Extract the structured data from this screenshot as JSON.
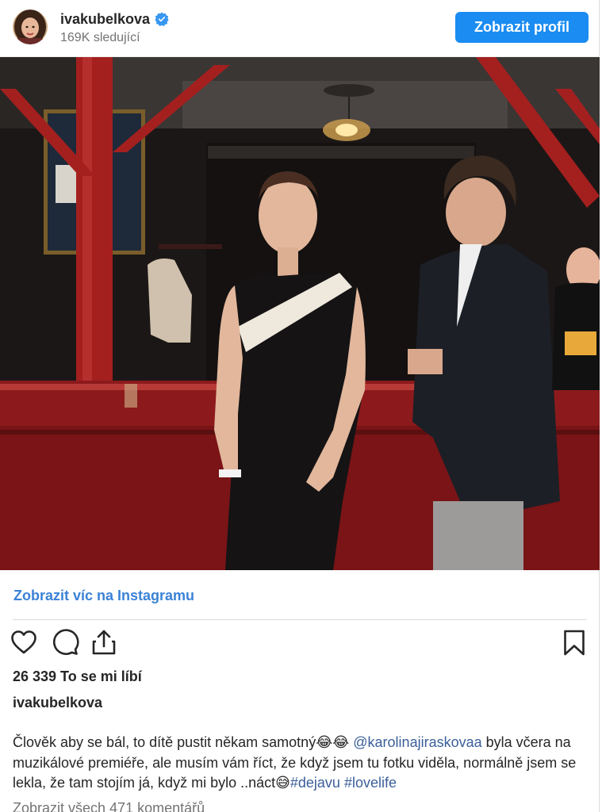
{
  "header": {
    "username": "ivakubelkova",
    "followers": "169K sledující",
    "profile_button": "Zobrazit profil",
    "verified_color": "#3897f0"
  },
  "post": {
    "photo_alt": "Photo of a young woman in a black and white one-shoulder dress next to a man in a dark suit jacket",
    "more_link": "Zobrazit víc na Instagramu",
    "likes": "26 339 To se mi líbí",
    "caption_user": "ivakubelkova",
    "caption_text_1": "Člověk aby se bál, to dítě pustit někam samotný😂😂 ",
    "caption_mention": "@karolinajiraskovaa",
    "caption_text_2": " byla včera na muzikálové premiéře, ale musím vám říct, že když jsem tu fotku viděla, normálně jsem se lekla, že tam stojím já, když mi bylo ..náct😅",
    "hashtag_1": "#dejavu",
    "hashtag_2": "#lovelife",
    "all_comments": "Zobrazit všech 471 komentářů"
  },
  "icons": {
    "like": "heart-icon",
    "comment": "comment-icon",
    "share": "share-icon",
    "save": "bookmark-icon",
    "verified": "verified-badge-icon"
  },
  "colors": {
    "button_blue": "#1a8cf2",
    "link_blue": "#3b82d6",
    "hashtag_blue": "#3b5f9a"
  }
}
